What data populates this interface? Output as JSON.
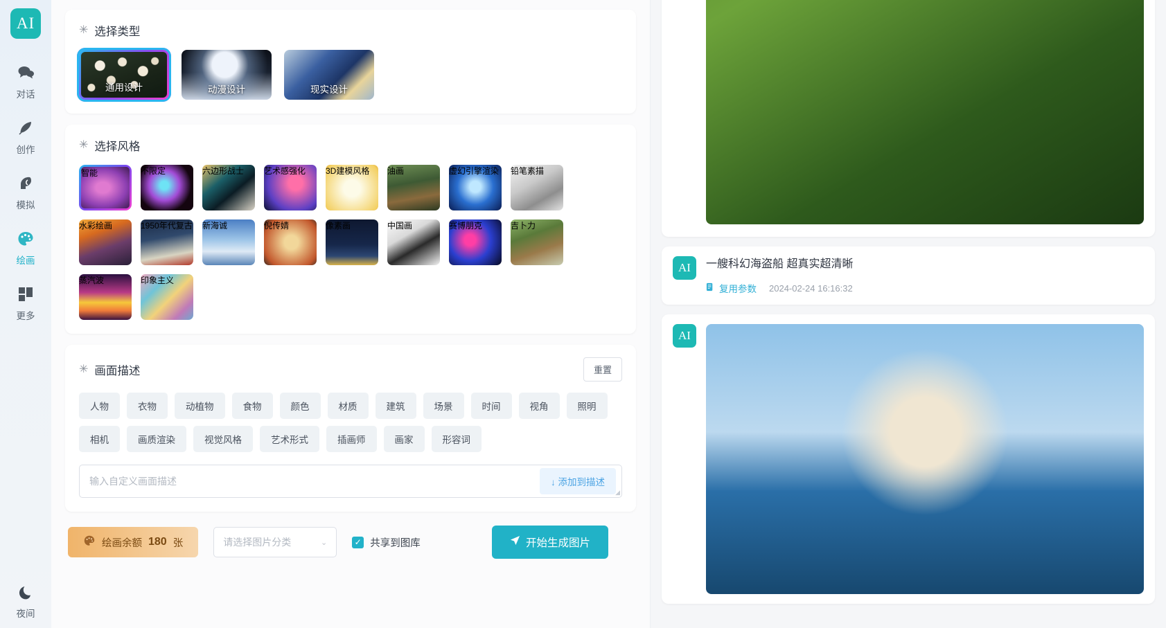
{
  "sidebar": {
    "logo": "AI",
    "items": [
      {
        "label": "对话",
        "icon": "chat-icon",
        "active": false
      },
      {
        "label": "创作",
        "icon": "feather-icon",
        "active": false
      },
      {
        "label": "模拟",
        "icon": "persona-icon",
        "active": false
      },
      {
        "label": "绘画",
        "icon": "palette-icon",
        "active": true
      },
      {
        "label": "更多",
        "icon": "grid-icon",
        "active": false
      }
    ],
    "bottom": {
      "label": "夜间",
      "icon": "moon-icon"
    }
  },
  "type_section": {
    "title": "选择类型",
    "sparkle": "✳",
    "options": [
      {
        "label": "通用设计",
        "selected": true,
        "art": "g-flowers"
      },
      {
        "label": "动漫设计",
        "selected": false,
        "art": "g-anime"
      },
      {
        "label": "现实设计",
        "selected": false,
        "art": "g-real"
      }
    ]
  },
  "style_section": {
    "title": "选择风格",
    "sparkle": "✳",
    "options": [
      {
        "label": "智能",
        "selected": true,
        "art": "g-smart"
      },
      {
        "label": "不限定",
        "selected": false,
        "art": "g-free"
      },
      {
        "label": "六边形战士",
        "selected": false,
        "art": "g-hex"
      },
      {
        "label": "艺术感强化",
        "selected": false,
        "art": "g-art"
      },
      {
        "label": "3D建模风格",
        "selected": false,
        "art": "g-3d"
      },
      {
        "label": "油画",
        "selected": false,
        "art": "g-oil"
      },
      {
        "label": "虚幻引擎渲染",
        "selected": false,
        "art": "g-unreal"
      },
      {
        "label": "铅笔素描",
        "selected": false,
        "art": "g-pencil"
      },
      {
        "label": "水彩绘画",
        "selected": false,
        "art": "g-water"
      },
      {
        "label": "1950年代复古",
        "selected": false,
        "art": "g-1950"
      },
      {
        "label": "新海诚",
        "selected": false,
        "art": "g-shinkai"
      },
      {
        "label": "倪传婧",
        "selected": false,
        "art": "g-ni"
      },
      {
        "label": "像素画",
        "selected": false,
        "art": "g-pixel"
      },
      {
        "label": "中国画",
        "selected": false,
        "art": "g-cn"
      },
      {
        "label": "赛博朋克",
        "selected": false,
        "art": "g-cyber"
      },
      {
        "label": "吉卜力",
        "selected": false,
        "art": "g-ghibli"
      },
      {
        "label": "蒸汽波",
        "selected": false,
        "art": "g-vapor"
      },
      {
        "label": "印象主义",
        "selected": false,
        "art": "g-impress"
      }
    ]
  },
  "desc_section": {
    "title": "画面描述",
    "sparkle": "✳",
    "reset_label": "重置",
    "tags": [
      "人物",
      "衣物",
      "动植物",
      "食物",
      "颜色",
      "材质",
      "建筑",
      "场景",
      "时间",
      "视角",
      "照明",
      "相机",
      "画质渲染",
      "视觉风格",
      "艺术形式",
      "插画师",
      "画家",
      "形容词"
    ],
    "input": {
      "value": "",
      "placeholder": "输入自定义画面描述"
    },
    "add_button": {
      "label": "添加到描述",
      "arrow": "↓"
    }
  },
  "bottom_bar": {
    "balance": {
      "icon": "palette-icon",
      "prefix": "绘画余额",
      "count": "180",
      "suffix": "张"
    },
    "category_select": {
      "placeholder": "请选择图片分类",
      "chevron": "⌄"
    },
    "share_checkbox": {
      "label": "共享到图库",
      "checked": true,
      "mark": "✓"
    },
    "generate_button": {
      "label": "开始生成图片",
      "icon": "send-icon"
    }
  },
  "right_panel": {
    "messages": [
      {
        "badge": "AI",
        "image_art": "g-squirrel",
        "image_alt": "squirrel-photo"
      },
      {
        "badge": "AI",
        "text": "一艘科幻海盗船 超真实超清晰",
        "reuse_label": "复用参数",
        "reuse_icon": "copy-icon",
        "timestamp": "2024-02-24 16:16:32"
      },
      {
        "badge": "AI",
        "image_art": "g-ship",
        "image_alt": "pirate-ship-photo"
      }
    ]
  },
  "colors": {
    "brand_teal": "#1db9b4",
    "accent_blue": "#33b0d6",
    "balance_orange": "#f0b46a",
    "selected_gradient_start": "#2ab6f0",
    "selected_gradient_end": "#ef3fd0"
  }
}
